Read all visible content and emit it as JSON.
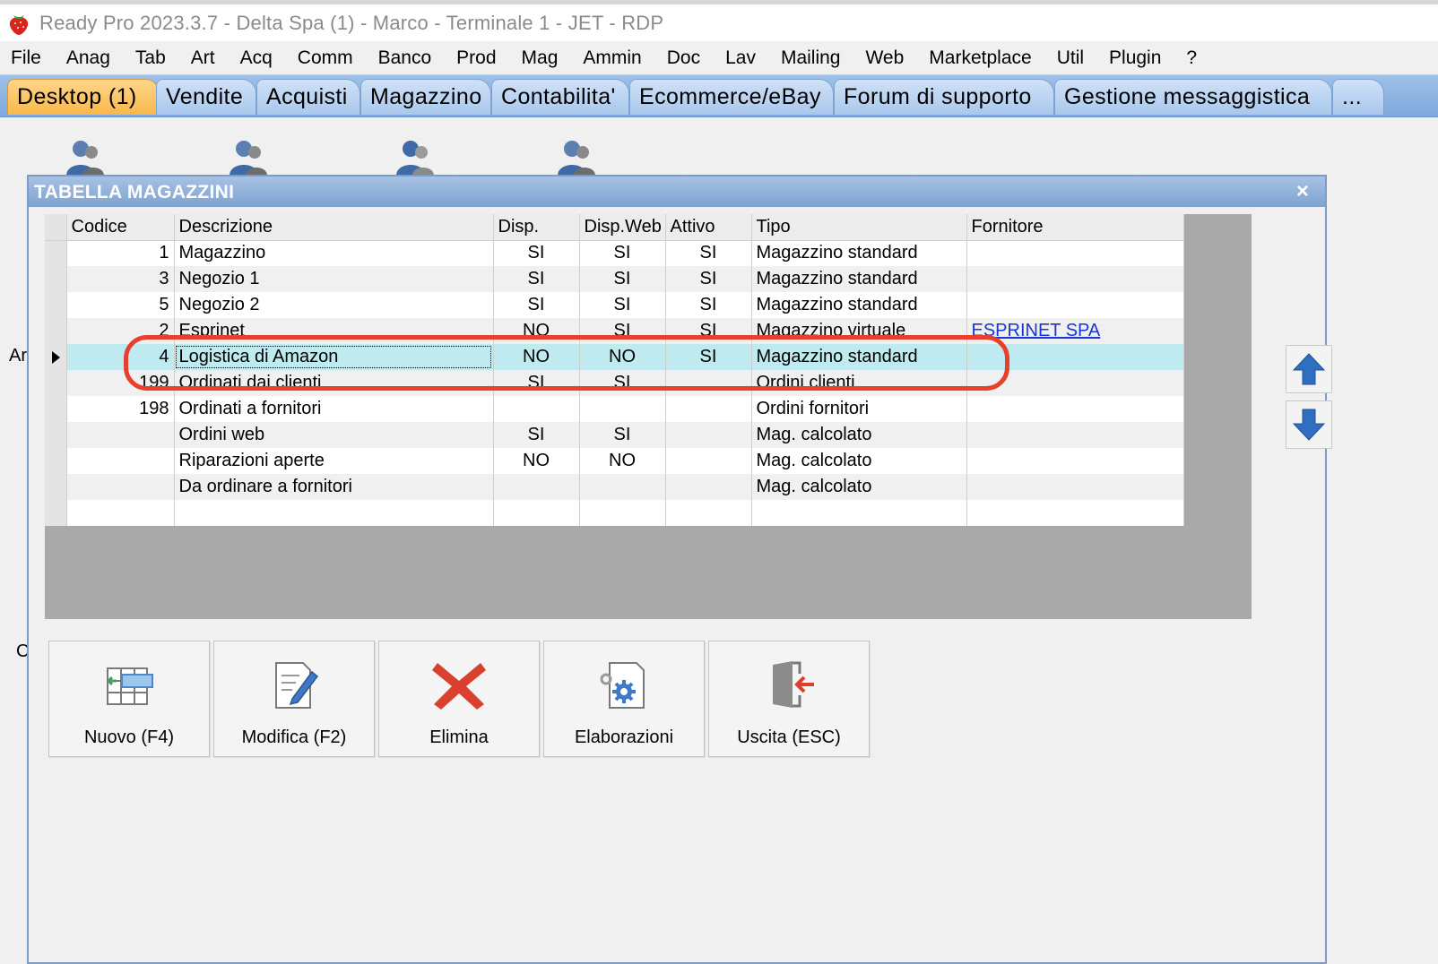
{
  "window": {
    "title": "Ready Pro 2023.3.7 - Delta Spa (1) - Marco - Terminale 1 - JET - RDP"
  },
  "menu": [
    "File",
    "Anag",
    "Tab",
    "Art",
    "Acq",
    "Comm",
    "Banco",
    "Prod",
    "Mag",
    "Ammin",
    "Doc",
    "Lav",
    "Mailing",
    "Web",
    "Marketplace",
    "Util",
    "Plugin",
    "?"
  ],
  "tabs": [
    "Desktop (1)",
    "Vendite",
    "Acquisti",
    "Magazzino",
    "Contabilita'",
    "Ecommerce/eBay",
    "Forum di supporto",
    "Gestione messaggistica",
    "..."
  ],
  "side_letters": [
    "Ar",
    "C"
  ],
  "dialog": {
    "title": "TABELLA MAGAZZINI",
    "close": "×"
  },
  "grid": {
    "columns": [
      "Codice",
      "Descrizione",
      "Disp.",
      "Disp.Web",
      "Attivo",
      "Tipo",
      "Fornitore"
    ],
    "rows": [
      {
        "codice": "1",
        "descrizione": "Magazzino",
        "disp": "SI",
        "dispweb": "SI",
        "attivo": "SI",
        "tipo": "Magazzino standard",
        "fornitore": ""
      },
      {
        "codice": "3",
        "descrizione": "Negozio 1",
        "disp": "SI",
        "dispweb": "SI",
        "attivo": "SI",
        "tipo": "Magazzino standard",
        "fornitore": ""
      },
      {
        "codice": "5",
        "descrizione": "Negozio 2",
        "disp": "SI",
        "dispweb": "SI",
        "attivo": "SI",
        "tipo": "Magazzino standard",
        "fornitore": ""
      },
      {
        "codice": "2",
        "descrizione": "Esprinet",
        "disp": "NO",
        "dispweb": "SI",
        "attivo": "SI",
        "tipo": "Magazzino virtuale",
        "fornitore": "ESPRINET SPA"
      },
      {
        "codice": "4",
        "descrizione": "Logistica di Amazon",
        "disp": "NO",
        "dispweb": "NO",
        "attivo": "SI",
        "tipo": "Magazzino standard",
        "fornitore": ""
      },
      {
        "codice": "199",
        "descrizione": "Ordinati dai clienti",
        "disp": "SI",
        "dispweb": "SI",
        "attivo": "",
        "tipo": "Ordini clienti",
        "fornitore": ""
      },
      {
        "codice": "198",
        "descrizione": "Ordinati a fornitori",
        "disp": "",
        "dispweb": "",
        "attivo": "",
        "tipo": "Ordini fornitori",
        "fornitore": ""
      },
      {
        "codice": "",
        "descrizione": "Ordini web",
        "disp": "SI",
        "dispweb": "SI",
        "attivo": "",
        "tipo": "Mag. calcolato",
        "fornitore": ""
      },
      {
        "codice": "",
        "descrizione": "Riparazioni aperte",
        "disp": "NO",
        "dispweb": "NO",
        "attivo": "",
        "tipo": "Mag. calcolato",
        "fornitore": ""
      },
      {
        "codice": "",
        "descrizione": "Da ordinare a fornitori",
        "disp": "",
        "dispweb": "",
        "attivo": "",
        "tipo": "Mag. calcolato",
        "fornitore": ""
      },
      {
        "codice": "",
        "descrizione": "",
        "disp": "",
        "dispweb": "",
        "attivo": "",
        "tipo": "",
        "fornitore": ""
      }
    ],
    "selected_row": 4
  },
  "buttons": {
    "nuovo": "Nuovo (F4)",
    "modifica": "Modifica (F2)",
    "elimina": "Elimina",
    "elaborazioni": "Elaborazioni",
    "uscita": "Uscita (ESC)"
  },
  "colors": {
    "highlight": "#e8402d",
    "selected_row": "#bfeaf0",
    "tab_active": "#f8b84a",
    "dialog_title": "#7ea2d1",
    "link": "#1a35d6"
  },
  "icons": [
    "strawberry-icon",
    "user-icon",
    "arrow-up-icon",
    "arrow-down-icon",
    "new-table-icon",
    "edit-document-icon",
    "delete-x-icon",
    "gear-document-icon",
    "exit-door-icon"
  ]
}
